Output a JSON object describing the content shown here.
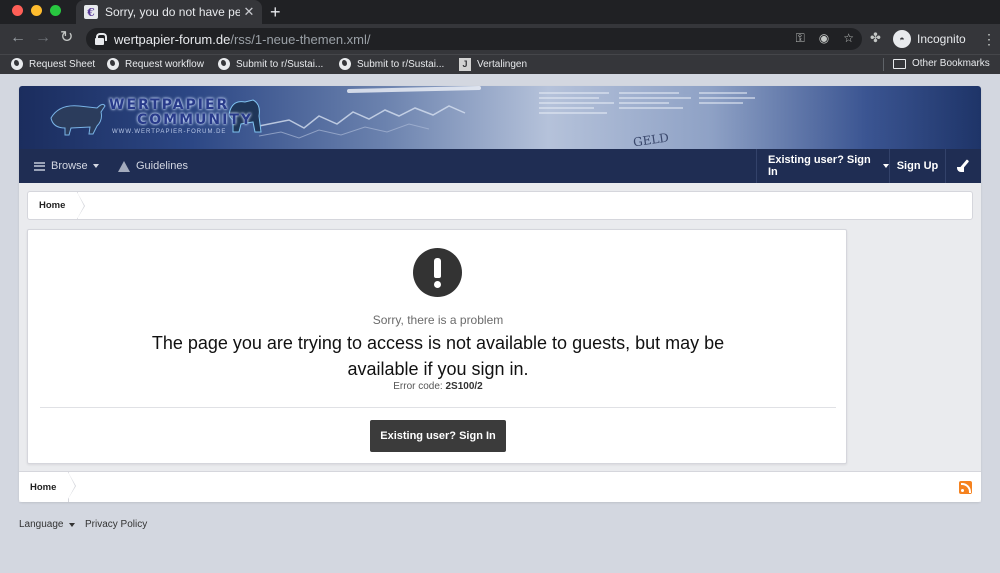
{
  "browser": {
    "tab_title": "Sorry, you do not have permission",
    "tab_favicon": "€",
    "new_tab_label": "+",
    "url_host": "wertpapier-forum.de",
    "url_path": "/rss/1-neue-themen.xml/",
    "profile_label": "Incognito",
    "traffic_colors": [
      "#ff5f57",
      "#febc2e",
      "#28c840"
    ]
  },
  "bookmarks": [
    {
      "label": "Request Sheet",
      "icon": "globe-icon"
    },
    {
      "label": "Request workflow",
      "icon": "globe-icon"
    },
    {
      "label": "Submit to r/Sustai...",
      "icon": "globe-icon"
    },
    {
      "label": "Submit to r/Sustai...",
      "icon": "globe-icon"
    },
    {
      "label": "Vertalingen",
      "icon": "j-icon",
      "glyph": "J"
    }
  ],
  "other_bookmarks": "Other Bookmarks",
  "site": {
    "logo_line1": "WERTPAPIER",
    "logo_line2": "COMMUNITY",
    "logo_url": "WWW.WERTPAPIER-FORUM.DE",
    "banner_word": "GELD",
    "nav": {
      "browse": "Browse",
      "guidelines": "Guidelines",
      "sign_in": "Existing user? Sign In",
      "sign_up": "Sign Up"
    },
    "breadcrumb_home": "Home",
    "error": {
      "subtitle": "Sorry, there is a problem",
      "message": "The page you are trying to access is not available to guests, but may be available if you sign in.",
      "code_label": "Error code: ",
      "code_value": "2S100/2",
      "button": "Existing user? Sign In"
    },
    "footer_home": "Home"
  },
  "page_footer": {
    "language": "Language",
    "privacy": "Privacy Policy"
  },
  "colors": {
    "nav_bg": "#1f2d53",
    "button_bg": "#3b3b3b",
    "rss": "#f5821f"
  }
}
